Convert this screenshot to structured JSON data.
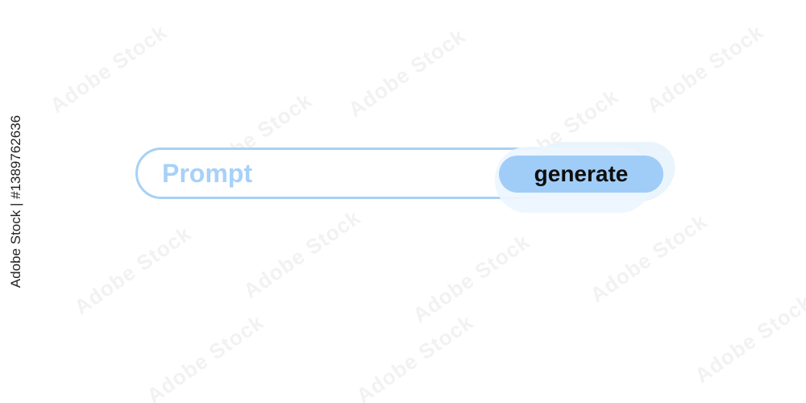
{
  "watermark": {
    "text": "Adobe Stock"
  },
  "side_id": "Adobe Stock | #1389762636",
  "prompt_bar": {
    "placeholder_text": "Prompt",
    "button_label": "generate"
  },
  "colors": {
    "bar_border": "#a8d1f5",
    "placeholder": "#a7d1f8",
    "button_fill": "#9fcdf7",
    "button_glow": "#eaf4fd",
    "button_text": "#0e0e0e"
  }
}
